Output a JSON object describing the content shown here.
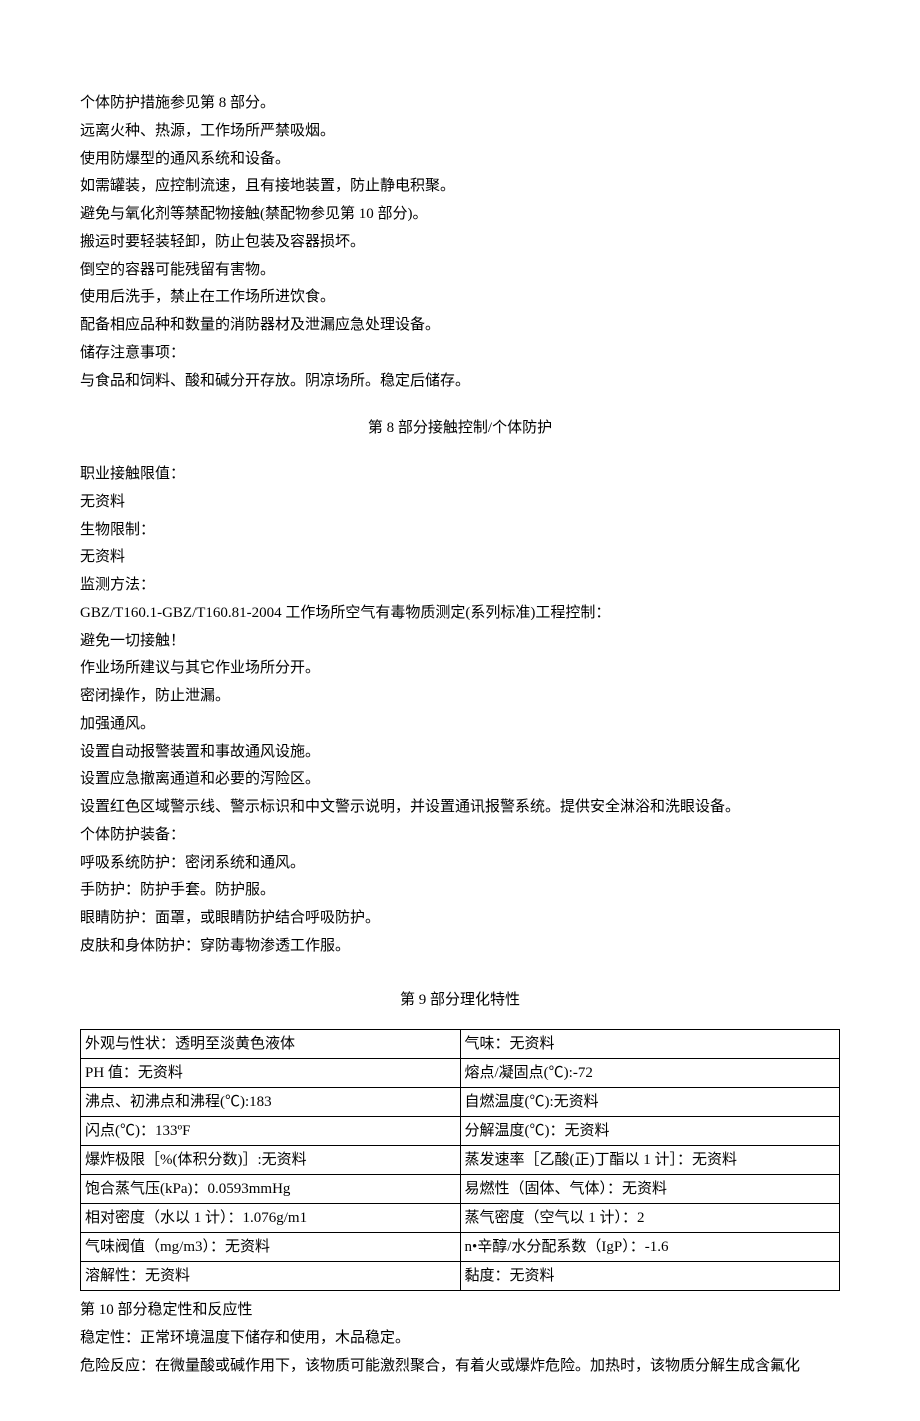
{
  "section7": {
    "lines": [
      "个体防护措施参见第 8 部分。",
      "远离火种、热源，工作场所严禁吸烟。",
      "使用防爆型的通风系统和设备。",
      "如需罐装，应控制流速，且有接地装置，防止静电积聚。",
      "避免与氧化剂等禁配物接触(禁配物参见第 10 部分)。",
      "搬运时要轻装轻卸，防止包装及容器损坏。",
      "倒空的容器可能残留有害物。",
      "使用后洗手，禁止在工作场所进饮食。",
      "配备相应品种和数量的消防器材及泄漏应急处理设备。",
      "储存注意事项：",
      "与食品和饲料、酸和碱分开存放。阴凉场所。稳定后储存。"
    ]
  },
  "section8": {
    "title": "第 8 部分接触控制/个体防护",
    "lines": [
      "职业接触限值：",
      "无资料",
      "生物限制：",
      "无资料",
      "监测方法：",
      "GBZ/T160.1-GBZ/T160.81-2004 工作场所空气有毒物质测定(系列标准)工程控制：",
      "避免一切接触！",
      "作业场所建议与其它作业场所分开。",
      "密闭操作，防止泄漏。",
      "加强通风。",
      "设置自动报警装置和事故通风设施。",
      "设置应急撤离通道和必要的泻险区。",
      "设置红色区域警示线、警示标识和中文警示说明，并设置通讯报警系统。提供安全淋浴和洗眼设备。",
      "个体防护装备：",
      "呼吸系统防护：密闭系统和通风。",
      "手防护：防护手套。防护服。",
      "眼睛防护：面罩，或眼睛防护结合呼吸防护。",
      "皮肤和身体防护：穿防毒物渗透工作服。"
    ]
  },
  "section9": {
    "title": "第 9 部分理化特性",
    "rows": [
      [
        "外观与性状：透明至淡黄色液体",
        "气味：无资料"
      ],
      [
        "PH 值：无资料",
        "熔点/凝固点(℃):-72"
      ],
      [
        "沸点、初沸点和沸程(℃):183",
        "自燃温度(℃):无资料"
      ],
      [
        "闪点(℃)：133ºF",
        "分解温度(℃)：无资料"
      ],
      [
        "爆炸极限［%(体积分数)］:无资料",
        "蒸发速率［乙酸(正)丁酯以 1 计］：无资料"
      ],
      [
        "饱合蒸气压(kPa)：0.0593mmHg",
        "易燃性（固体、气体）：无资料"
      ],
      [
        "相对密度（水以 1 计）：1.076g/m1",
        "蒸气密度（空气以 1 计）：2"
      ],
      [
        "气味阀值（mg/m3）：无资料",
        "n•辛醇/水分配系数（IgP）：-1.6"
      ],
      [
        "溶解性：无资料",
        "黏度：无资料"
      ]
    ]
  },
  "section10": {
    "lines": [
      "第 10 部分稳定性和反应性",
      "稳定性：正常环境温度下储存和使用，木品稳定。",
      "危险反应：在微量酸或碱作用下，该物质可能激烈聚合，有着火或爆炸危险。加热时，该物质分解生成含氟化"
    ]
  },
  "chart_data": {
    "type": "table",
    "title": "第 9 部分理化特性",
    "rows": [
      {
        "property": "外观与性状",
        "value": "透明至淡黄色液体",
        "property2": "气味",
        "value2": "无资料"
      },
      {
        "property": "PH 值",
        "value": "无资料",
        "property2": "熔点/凝固点(℃)",
        "value2": "-72"
      },
      {
        "property": "沸点、初沸点和沸程(℃)",
        "value": "183",
        "property2": "自燃温度(℃)",
        "value2": "无资料"
      },
      {
        "property": "闪点(℃)",
        "value": "133ºF",
        "property2": "分解温度(℃)",
        "value2": "无资料"
      },
      {
        "property": "爆炸极限［%(体积分数)］",
        "value": "无资料",
        "property2": "蒸发速率［乙酸(正)丁酯以 1 计］",
        "value2": "无资料"
      },
      {
        "property": "饱合蒸气压(kPa)",
        "value": "0.0593mmHg",
        "property2": "易燃性（固体、气体）",
        "value2": "无资料"
      },
      {
        "property": "相对密度（水以 1 计）",
        "value": "1.076g/m1",
        "property2": "蒸气密度（空气以 1 计）",
        "value2": "2"
      },
      {
        "property": "气味阀值（mg/m3）",
        "value": "无资料",
        "property2": "n•辛醇/水分配系数（IgP）",
        "value2": "-1.6"
      },
      {
        "property": "溶解性",
        "value": "无资料",
        "property2": "黏度",
        "value2": "无资料"
      }
    ]
  }
}
